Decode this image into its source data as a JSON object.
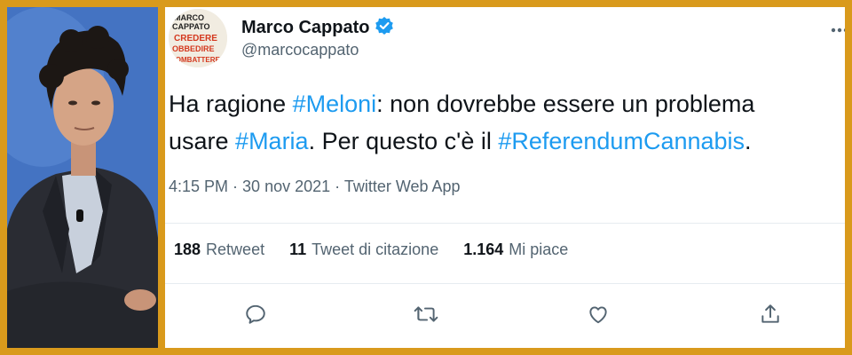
{
  "tweet": {
    "author_name": "Marco Cappato",
    "handle": "@marcocappato",
    "text_1": "Ha ragione ",
    "tag_1": "#Meloni",
    "text_2": ": non dovrebbe essere un problema",
    "text_3": "usare ",
    "tag_2": "#Maria",
    "text_4": ". Per questo c'è il ",
    "tag_3": "#ReferendumCannabis",
    "text_5": ".",
    "time": "4:15 PM",
    "separator_1": " · ",
    "date": "30 nov 2021",
    "separator_2": " · ",
    "source": "Twitter Web App"
  },
  "avatar_text": [
    "MARCO",
    "CAPPATO",
    "CREDERE",
    "OBBEDIRE",
    "COMBATTERE"
  ],
  "stats": {
    "retweets_count": "188",
    "retweets_label": "Retweet",
    "quotes_count": "11",
    "quotes_label": "Tweet di citazione",
    "likes_count": "1.164",
    "likes_label": "Mi piace"
  },
  "icons": {
    "verified": "verified-badge-icon",
    "more": "more-options-icon",
    "reply": "reply-icon",
    "retweet": "retweet-icon",
    "like": "like-icon",
    "share": "share-icon"
  },
  "colors": {
    "frame": "#d99a1c",
    "hashtag": "#1d9bf0",
    "verified": "#1d9bf0",
    "text": "#0f1419",
    "muted": "#536471"
  }
}
